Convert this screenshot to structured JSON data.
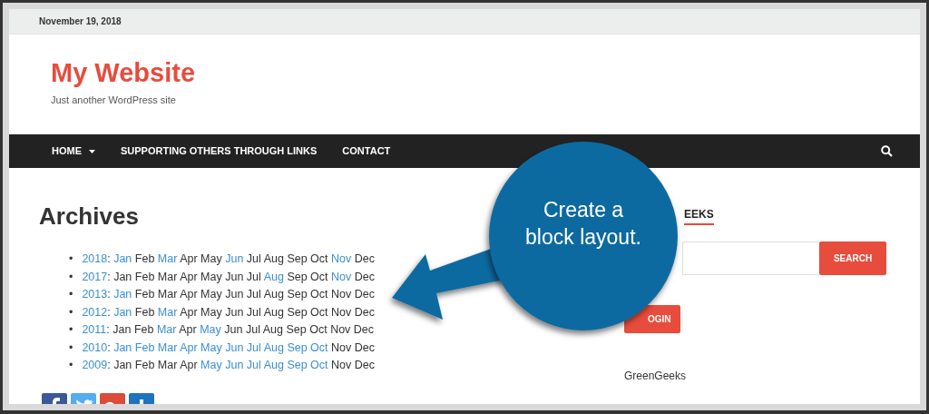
{
  "top_bar": {
    "date": "November 19, 2018"
  },
  "header": {
    "site_title": "My Website",
    "tagline": "Just another WordPress site"
  },
  "nav": {
    "items": [
      {
        "label": "HOME",
        "has_dropdown": true
      },
      {
        "label": "SUPPORTING OTHERS THROUGH LINKS",
        "has_dropdown": false
      },
      {
        "label": "CONTACT",
        "has_dropdown": false
      }
    ]
  },
  "main": {
    "heading": "Archives",
    "archives": [
      {
        "marker": "•",
        "year": "2018",
        "sep": ":",
        "months": [
          {
            "label": "Jan",
            "linked": true
          },
          {
            "label": "Feb",
            "linked": false
          },
          {
            "label": "Mar",
            "linked": true
          },
          {
            "label": "Apr",
            "linked": false
          },
          {
            "label": "May",
            "linked": false
          },
          {
            "label": "Jun",
            "linked": true
          },
          {
            "label": "Jul",
            "linked": false
          },
          {
            "label": "Aug",
            "linked": false
          },
          {
            "label": "Sep",
            "linked": false
          },
          {
            "label": "Oct",
            "linked": false
          },
          {
            "label": "Nov",
            "linked": true
          },
          {
            "label": "Dec",
            "linked": false
          }
        ]
      },
      {
        "marker": "•",
        "year": "2017",
        "sep": ":",
        "months": [
          {
            "label": "Jan",
            "linked": false
          },
          {
            "label": "Feb",
            "linked": false
          },
          {
            "label": "Mar",
            "linked": false
          },
          {
            "label": "Apr",
            "linked": false
          },
          {
            "label": "May",
            "linked": false
          },
          {
            "label": "Jun",
            "linked": false
          },
          {
            "label": "Jul",
            "linked": false
          },
          {
            "label": "Aug",
            "linked": true
          },
          {
            "label": "Sep",
            "linked": false
          },
          {
            "label": "Oct",
            "linked": false
          },
          {
            "label": "Nov",
            "linked": true
          },
          {
            "label": "Dec",
            "linked": false
          }
        ]
      },
      {
        "marker": "•",
        "year": "2013",
        "sep": ":",
        "months": [
          {
            "label": "Jan",
            "linked": true
          },
          {
            "label": "Feb",
            "linked": false
          },
          {
            "label": "Mar",
            "linked": false
          },
          {
            "label": "Apr",
            "linked": false
          },
          {
            "label": "May",
            "linked": false
          },
          {
            "label": "Jun",
            "linked": false
          },
          {
            "label": "Jul",
            "linked": false
          },
          {
            "label": "Aug",
            "linked": false
          },
          {
            "label": "Sep",
            "linked": false
          },
          {
            "label": "Oct",
            "linked": false
          },
          {
            "label": "Nov",
            "linked": false
          },
          {
            "label": "Dec",
            "linked": false
          }
        ]
      },
      {
        "marker": "•",
        "year": "2012",
        "sep": ":",
        "months": [
          {
            "label": "Jan",
            "linked": true
          },
          {
            "label": "Feb",
            "linked": false
          },
          {
            "label": "Mar",
            "linked": true
          },
          {
            "label": "Apr",
            "linked": false
          },
          {
            "label": "May",
            "linked": false
          },
          {
            "label": "Jun",
            "linked": false
          },
          {
            "label": "Jul",
            "linked": false
          },
          {
            "label": "Aug",
            "linked": false
          },
          {
            "label": "Sep",
            "linked": false
          },
          {
            "label": "Oct",
            "linked": false
          },
          {
            "label": "Nov",
            "linked": false
          },
          {
            "label": "Dec",
            "linked": false
          }
        ]
      },
      {
        "marker": "•",
        "year": "2011",
        "sep": ":",
        "months": [
          {
            "label": "Jan",
            "linked": false
          },
          {
            "label": "Feb",
            "linked": false
          },
          {
            "label": "Mar",
            "linked": true
          },
          {
            "label": "Apr",
            "linked": false
          },
          {
            "label": "May",
            "linked": true
          },
          {
            "label": "Jun",
            "linked": false
          },
          {
            "label": "Jul",
            "linked": false
          },
          {
            "label": "Aug",
            "linked": false
          },
          {
            "label": "Sep",
            "linked": false
          },
          {
            "label": "Oct",
            "linked": false
          },
          {
            "label": "Nov",
            "linked": false
          },
          {
            "label": "Dec",
            "linked": false
          }
        ]
      },
      {
        "marker": "•",
        "year": "2010",
        "sep": ":",
        "months": [
          {
            "label": "Jan",
            "linked": true
          },
          {
            "label": "Feb",
            "linked": true
          },
          {
            "label": "Mar",
            "linked": true
          },
          {
            "label": "Apr",
            "linked": true
          },
          {
            "label": "May",
            "linked": true
          },
          {
            "label": "Jun",
            "linked": true
          },
          {
            "label": "Jul",
            "linked": true
          },
          {
            "label": "Aug",
            "linked": true
          },
          {
            "label": "Sep",
            "linked": true
          },
          {
            "label": "Oct",
            "linked": true
          },
          {
            "label": "Nov",
            "linked": false
          },
          {
            "label": "Dec",
            "linked": false
          }
        ]
      },
      {
        "marker": "•",
        "year": "2009",
        "sep": ":",
        "months": [
          {
            "label": "Jan",
            "linked": false
          },
          {
            "label": "Feb",
            "linked": false
          },
          {
            "label": "Mar",
            "linked": false
          },
          {
            "label": "Apr",
            "linked": false
          },
          {
            "label": "May",
            "linked": true
          },
          {
            "label": "Jun",
            "linked": true
          },
          {
            "label": "Jul",
            "linked": true
          },
          {
            "label": "Aug",
            "linked": true
          },
          {
            "label": "Sep",
            "linked": true
          },
          {
            "label": "Oct",
            "linked": true
          },
          {
            "label": "Nov",
            "linked": false
          },
          {
            "label": "Dec",
            "linked": false
          }
        ]
      }
    ],
    "share_buttons": [
      {
        "kind": "facebook"
      },
      {
        "kind": "twitter"
      },
      {
        "kind": "googleplus"
      },
      {
        "kind": "share"
      }
    ]
  },
  "sidebar": {
    "widget_heading": "EEKS",
    "search_button": "SEARCH",
    "login_button": "OGIN",
    "text": "GreenGeeks"
  },
  "callout": {
    "text": "Create a block layout."
  }
}
